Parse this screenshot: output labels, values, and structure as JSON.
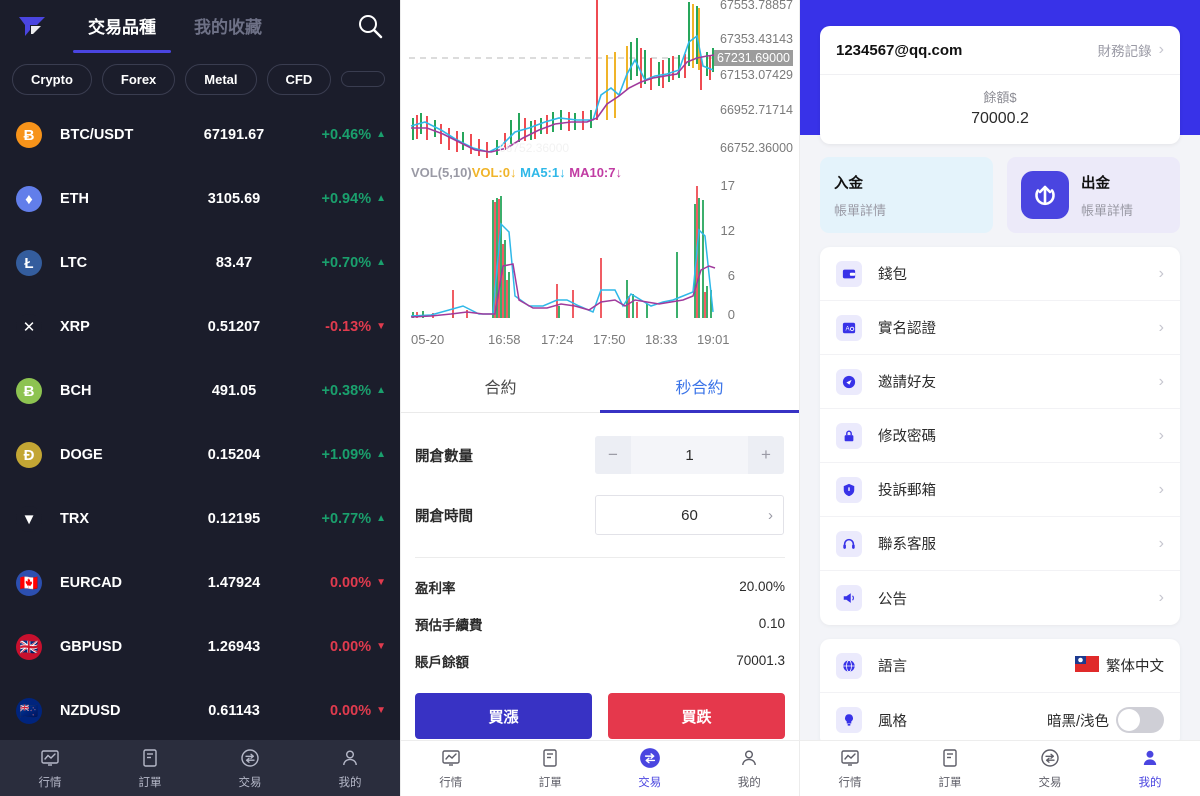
{
  "market": {
    "logo": "brand-logo",
    "tabs": [
      {
        "label": "交易品種",
        "active": true
      },
      {
        "label": "我的收藏",
        "active": false
      }
    ],
    "search_icon": "search-icon",
    "categories": [
      "Crypto",
      "Forex",
      "Metal",
      "CFD",
      ""
    ],
    "rows": [
      {
        "symbol": "BTC/USDT",
        "price": "67191.67",
        "change": "+0.46%",
        "dir": "up",
        "icon_text": "Ƀ",
        "icon_bg": "#f7931a"
      },
      {
        "symbol": "ETH",
        "price": "3105.69",
        "change": "+0.94%",
        "dir": "up",
        "icon_text": "♦",
        "icon_bg": "#627eea"
      },
      {
        "symbol": "LTC",
        "price": "83.47",
        "change": "+0.70%",
        "dir": "up",
        "icon_text": "Ł",
        "icon_bg": "#345d9d"
      },
      {
        "symbol": "XRP",
        "price": "0.51207",
        "change": "-0.13%",
        "dir": "down",
        "icon_text": "✕",
        "icon_bg": "#1b1d2b"
      },
      {
        "symbol": "BCH",
        "price": "491.05",
        "change": "+0.38%",
        "dir": "up",
        "icon_text": "Ƀ",
        "icon_bg": "#8dc351"
      },
      {
        "symbol": "DOGE",
        "price": "0.15204",
        "change": "+1.09%",
        "dir": "up",
        "icon_text": "Ð",
        "icon_bg": "#c3a634"
      },
      {
        "symbol": "TRX",
        "price": "0.12195",
        "change": "+0.77%",
        "dir": "up",
        "icon_text": "▼",
        "icon_bg": "#1b1d2b"
      },
      {
        "symbol": "EURCAD",
        "price": "1.47924",
        "change": "0.00%",
        "dir": "down",
        "icon_text": "🇨🇦",
        "icon_bg": "#2c4fb0"
      },
      {
        "symbol": "GBPUSD",
        "price": "1.26943",
        "change": "0.00%",
        "dir": "down",
        "icon_text": "🇬🇧",
        "icon_bg": "#c8102e"
      },
      {
        "symbol": "NZDUSD",
        "price": "0.61143",
        "change": "0.00%",
        "dir": "down",
        "icon_text": "🇳🇿",
        "icon_bg": "#00247d"
      }
    ],
    "bottom_nav": [
      {
        "label": "行情",
        "icon": "quotes-icon",
        "active": false
      },
      {
        "label": "訂單",
        "icon": "orders-icon",
        "active": false
      },
      {
        "label": "交易",
        "icon": "trade-icon",
        "active": false
      },
      {
        "label": "我的",
        "icon": "profile-icon",
        "active": false
      }
    ]
  },
  "chart_data": {
    "type": "line",
    "title": "",
    "price_axis_labels": [
      "67553.78857",
      "67353.43143",
      "67153.07429",
      "66952.71714",
      "66752.36000"
    ],
    "current_price": "67231.69000",
    "volume_legend": {
      "indicator": "VOL(5,10)",
      "vol": "VOL:0↓",
      "ma5": "MA5:1↓",
      "ma10": "MA10:7↓"
    },
    "volume_axis_labels": [
      "17",
      "12",
      "6",
      "0"
    ],
    "x_ticks": [
      "05-20",
      "16:58",
      "17:24",
      "17:50",
      "18:33",
      "19:01"
    ],
    "ylim": [
      66752.36,
      67553.78857
    ],
    "vol_ylim": [
      0,
      18
    ],
    "grid": false,
    "colors": {
      "up": "#26a65b",
      "down": "#ef4b52",
      "ma5": "#2fb8e8",
      "ma10": "#c13ca3",
      "vol": "#f0b429"
    }
  },
  "trade": {
    "tabs": [
      {
        "label": "合約",
        "active": false
      },
      {
        "label": "秒合約",
        "active": true
      }
    ],
    "qty": {
      "label": "開倉數量",
      "value": "1",
      "minus": "−",
      "plus": "+"
    },
    "duration": {
      "label": "開倉時間",
      "value": "60"
    },
    "info": [
      {
        "key": "盈利率",
        "value": "20.00%"
      },
      {
        "key": "預估手續費",
        "value": "0.10"
      },
      {
        "key": "賬戶餘額",
        "value": "70001.3"
      }
    ],
    "buy_label": "買漲",
    "sell_label": "買跌",
    "bottom_nav": [
      {
        "label": "行情",
        "icon": "quotes-icon",
        "active": false
      },
      {
        "label": "訂單",
        "icon": "orders-icon",
        "active": false
      },
      {
        "label": "交易",
        "icon": "trade-icon",
        "active": true
      },
      {
        "label": "我的",
        "icon": "profile-icon",
        "active": false
      }
    ]
  },
  "profile": {
    "account": {
      "email": "1234567@qq.com",
      "records_label": "財務記錄",
      "balance_label": "餘額$",
      "balance_value": "70000.2"
    },
    "funds": [
      {
        "title": "入金",
        "subtitle": "帳單詳情",
        "icon": "deposit-icon",
        "has_icon": false
      },
      {
        "title": "出金",
        "subtitle": "帳單詳情",
        "icon": "withdraw-icon",
        "has_icon": true
      }
    ],
    "menu": [
      {
        "label": "錢包",
        "icon": "wallet-icon"
      },
      {
        "label": "實名認證",
        "icon": "id-verify-icon"
      },
      {
        "label": "邀請好友",
        "icon": "invite-friend-icon"
      },
      {
        "label": "修改密碼",
        "icon": "lock-icon"
      },
      {
        "label": "投訴郵箱",
        "icon": "shield-icon"
      },
      {
        "label": "聯系客服",
        "icon": "headset-icon"
      },
      {
        "label": "公告",
        "icon": "megaphone-icon"
      }
    ],
    "settings": [
      {
        "label": "語言",
        "icon": "globe-icon",
        "value": "繁体中文",
        "type": "value"
      },
      {
        "label": "風格",
        "icon": "bulb-icon",
        "value": "暗黑/浅色",
        "type": "toggle"
      }
    ],
    "bottom_nav": [
      {
        "label": "行情",
        "icon": "quotes-icon",
        "active": false
      },
      {
        "label": "訂單",
        "icon": "orders-icon",
        "active": false
      },
      {
        "label": "交易",
        "icon": "trade-icon",
        "active": false
      },
      {
        "label": "我的",
        "icon": "profile-icon",
        "active": true
      }
    ]
  },
  "theme": {
    "brand": "#3832c4",
    "accent": "#4a45e0",
    "up": "#1aa06d",
    "down": "#e13b4e",
    "dark_bg": "#1b1d2b"
  }
}
